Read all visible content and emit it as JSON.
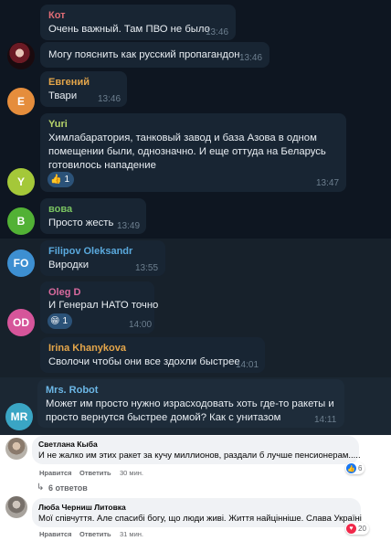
{
  "messages": [
    {
      "name": "Кот",
      "name_color": "#e06c75",
      "text": "Очень важный. Там ПВО не было",
      "time": "13:46"
    },
    {
      "avatar": "photo",
      "text": "Могу пояснить как русский пропагандон",
      "time": "13:46"
    },
    {
      "name": "Евгений",
      "name_color": "#e5a64a",
      "avatar_letter": "E",
      "avatar_color": "#e58d3c",
      "text": "Твари",
      "time": "13:46"
    },
    {
      "name": "Yuri",
      "name_color": "#b8d56a",
      "avatar_letter": "Y",
      "avatar_color": "#a4c839",
      "text_lines": [
        "Химлабаратория, танковый завод и база Азова в одном",
        "помещении были, однозначно. И еще оттуда на Беларусь",
        "готовилось нападение"
      ],
      "reaction": {
        "emoji": "👍",
        "count": "1"
      },
      "time": "13:47"
    },
    {
      "name": "вова",
      "name_color": "#7ac461",
      "avatar_letter": "B",
      "avatar_color": "#52b135",
      "text": "Просто жесть",
      "time": "13:49"
    },
    {
      "name": "Filipov Oleksandr",
      "name_color": "#5aa9dd",
      "avatar_letter": "FO",
      "avatar_color": "#3d8fd1",
      "text": "Виродки",
      "time": "13:55"
    },
    {
      "name": "Oleg D",
      "name_color": "#d86a9e",
      "avatar_letter": "OD",
      "avatar_color": "#d6559a",
      "text": "И Генерал НАТО точно",
      "reaction": {
        "emoji": "😁",
        "count": "1"
      },
      "time": "14:00"
    },
    {
      "name": "Irina Khanykova",
      "name_color": "#e5a64a",
      "text": "Сволочи чтобы они все здохли быстрее",
      "time": "14:01"
    },
    {
      "name": "Mrs. Robot",
      "name_color": "#6cb7e6",
      "avatar_letter": "MR",
      "avatar_color": "#3aa5c4",
      "text_lines": [
        "Может им просто нужно израсходовать хоть где-то ракеты и",
        "просто вернутся быстрее домой? Как с унитазом"
      ],
      "time": "14:11"
    }
  ],
  "comments": [
    {
      "name": "Светлана Кыба",
      "text": "И не жалко им этих ракет за кучу миллионов, раздали б лучше пенсионерам.....",
      "like": "Нравится",
      "reply": "Ответить",
      "time": "30 мин.",
      "reactions": "6",
      "replies": "6 ответов"
    },
    {
      "name": "Люба Черниш Литовка",
      "text": "Мої співчуття. Але спасибі богу, що люди живі. Життя найцінніше. Слава Україні",
      "like": "Нравится",
      "reply": "Ответить",
      "time": "31 мин.",
      "reactions": "20"
    }
  ]
}
